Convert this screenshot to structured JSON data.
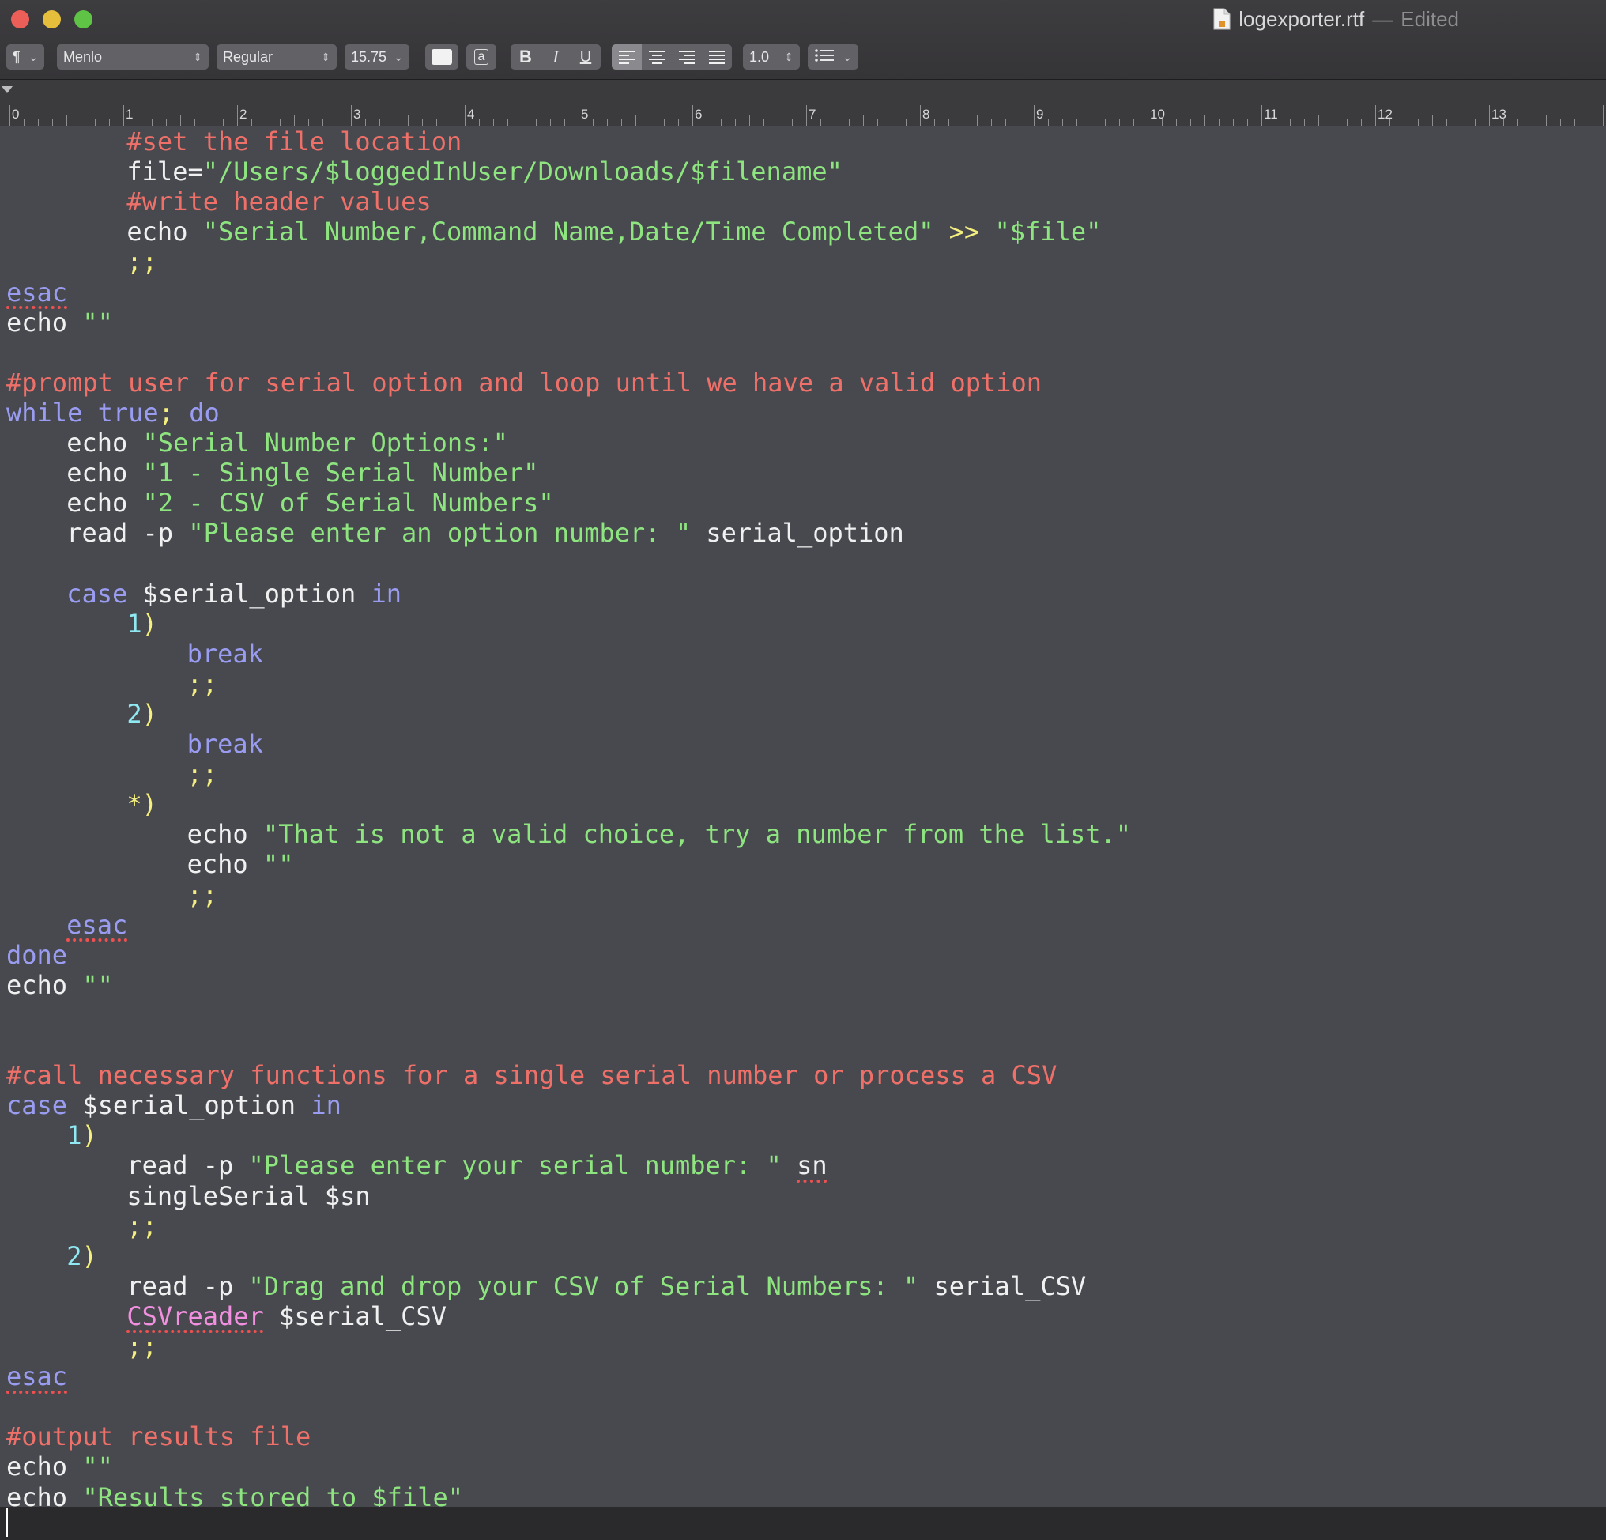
{
  "window": {
    "filename": "logexporter.rtf",
    "separator": "—",
    "status": "Edited",
    "traffic_lights": {
      "close": "#ec5f58",
      "minimize": "#e5bf3c",
      "zoom": "#5fc346"
    }
  },
  "toolbar": {
    "paragraph_style": "¶",
    "font_family": "Menlo",
    "font_style": "Regular",
    "font_size": "15.75",
    "highlight_label": "a",
    "bold": "B",
    "italic": "I",
    "underline": "U",
    "line_spacing": "1.0",
    "list_icon": "list-bullets-icon"
  },
  "ruler": {
    "numbers": [
      "0",
      "1",
      "2",
      "3",
      "4",
      "5",
      "6",
      "7",
      "8",
      "9",
      "10",
      "11",
      "12",
      "13"
    ]
  },
  "editor": {
    "lines": [
      {
        "indent": 8,
        "segs": [
          {
            "t": "#set the file location",
            "c": "cm"
          }
        ]
      },
      {
        "indent": 8,
        "segs": [
          {
            "t": "file=",
            "c": ""
          },
          {
            "t": "\"/Users/$loggedInUser/Downloads/$filename\"",
            "c": "st"
          }
        ]
      },
      {
        "indent": 8,
        "segs": [
          {
            "t": "#write header values",
            "c": "cm"
          }
        ]
      },
      {
        "indent": 8,
        "segs": [
          {
            "t": "echo ",
            "c": ""
          },
          {
            "t": "\"Serial Number,Command Name,Date/Time Completed\"",
            "c": "st"
          },
          {
            "t": " >> ",
            "c": "pu"
          },
          {
            "t": "\"$file\"",
            "c": "st"
          }
        ]
      },
      {
        "indent": 8,
        "segs": [
          {
            "t": ";;",
            "c": "pu"
          }
        ]
      },
      {
        "indent": 0,
        "segs": [
          {
            "t": "esac",
            "c": "kw sp"
          }
        ]
      },
      {
        "indent": 0,
        "segs": [
          {
            "t": "echo ",
            "c": ""
          },
          {
            "t": "\"\"",
            "c": "st"
          }
        ]
      },
      {
        "indent": 0,
        "segs": []
      },
      {
        "indent": 0,
        "segs": [
          {
            "t": "#prompt user for serial option and loop until we have a valid option",
            "c": "cm"
          }
        ]
      },
      {
        "indent": 0,
        "segs": [
          {
            "t": "while true",
            "c": "kw"
          },
          {
            "t": "; ",
            "c": "pu"
          },
          {
            "t": "do",
            "c": "kw"
          }
        ]
      },
      {
        "indent": 4,
        "segs": [
          {
            "t": "echo ",
            "c": ""
          },
          {
            "t": "\"Serial Number Options:\"",
            "c": "st"
          }
        ]
      },
      {
        "indent": 4,
        "segs": [
          {
            "t": "echo ",
            "c": ""
          },
          {
            "t": "\"1 - Single Serial Number\"",
            "c": "st"
          }
        ]
      },
      {
        "indent": 4,
        "segs": [
          {
            "t": "echo ",
            "c": ""
          },
          {
            "t": "\"2 - CSV of Serial Numbers\"",
            "c": "st"
          }
        ]
      },
      {
        "indent": 4,
        "segs": [
          {
            "t": "read -p ",
            "c": ""
          },
          {
            "t": "\"Please enter an option number: \"",
            "c": "st"
          },
          {
            "t": " serial_option",
            "c": ""
          }
        ]
      },
      {
        "indent": 0,
        "segs": []
      },
      {
        "indent": 4,
        "segs": [
          {
            "t": "case ",
            "c": "kw"
          },
          {
            "t": "$serial_option ",
            "c": ""
          },
          {
            "t": "in",
            "c": "kw"
          }
        ]
      },
      {
        "indent": 8,
        "segs": [
          {
            "t": "1",
            "c": "nm"
          },
          {
            "t": ")",
            "c": "pu"
          }
        ]
      },
      {
        "indent": 12,
        "segs": [
          {
            "t": "break",
            "c": "kw"
          }
        ]
      },
      {
        "indent": 12,
        "segs": [
          {
            "t": ";;",
            "c": "pu"
          }
        ]
      },
      {
        "indent": 8,
        "segs": [
          {
            "t": "2",
            "c": "nm"
          },
          {
            "t": ")",
            "c": "pu"
          }
        ]
      },
      {
        "indent": 12,
        "segs": [
          {
            "t": "break",
            "c": "kw"
          }
        ]
      },
      {
        "indent": 12,
        "segs": [
          {
            "t": ";;",
            "c": "pu"
          }
        ]
      },
      {
        "indent": 8,
        "segs": [
          {
            "t": "*)",
            "c": "pu"
          }
        ]
      },
      {
        "indent": 12,
        "segs": [
          {
            "t": "echo ",
            "c": ""
          },
          {
            "t": "\"That is not a valid choice, try a number from the list.\"",
            "c": "st"
          }
        ]
      },
      {
        "indent": 12,
        "segs": [
          {
            "t": "echo ",
            "c": ""
          },
          {
            "t": "\"\"",
            "c": "st"
          }
        ]
      },
      {
        "indent": 12,
        "segs": [
          {
            "t": ";;",
            "c": "pu"
          }
        ]
      },
      {
        "indent": 4,
        "segs": [
          {
            "t": "esac",
            "c": "kw sp"
          }
        ]
      },
      {
        "indent": 0,
        "segs": [
          {
            "t": "done",
            "c": "kw"
          }
        ]
      },
      {
        "indent": 0,
        "segs": [
          {
            "t": "echo ",
            "c": ""
          },
          {
            "t": "\"\"",
            "c": "st"
          }
        ]
      },
      {
        "indent": 0,
        "segs": []
      },
      {
        "indent": 0,
        "segs": []
      },
      {
        "indent": 0,
        "segs": [
          {
            "t": "#call necessary functions for a single serial number or process a CSV",
            "c": "cm"
          }
        ]
      },
      {
        "indent": 0,
        "segs": [
          {
            "t": "case ",
            "c": "kw"
          },
          {
            "t": "$serial_option ",
            "c": ""
          },
          {
            "t": "in",
            "c": "kw"
          }
        ]
      },
      {
        "indent": 4,
        "segs": [
          {
            "t": "1",
            "c": "nm"
          },
          {
            "t": ")",
            "c": "pu"
          }
        ]
      },
      {
        "indent": 8,
        "segs": [
          {
            "t": "read -p ",
            "c": ""
          },
          {
            "t": "\"Please enter your serial number: \"",
            "c": "st"
          },
          {
            "t": " ",
            "c": ""
          },
          {
            "t": "sn",
            "c": "sp"
          }
        ]
      },
      {
        "indent": 8,
        "segs": [
          {
            "t": "singleSerial $sn",
            "c": ""
          }
        ]
      },
      {
        "indent": 8,
        "segs": [
          {
            "t": ";;",
            "c": "pu"
          }
        ]
      },
      {
        "indent": 4,
        "segs": [
          {
            "t": "2",
            "c": "nm"
          },
          {
            "t": ")",
            "c": "pu"
          }
        ]
      },
      {
        "indent": 8,
        "segs": [
          {
            "t": "read -p ",
            "c": ""
          },
          {
            "t": "\"Drag and drop your CSV of Serial Numbers: \"",
            "c": "st"
          },
          {
            "t": " serial_CSV",
            "c": ""
          }
        ]
      },
      {
        "indent": 8,
        "segs": [
          {
            "t": "CSVreader",
            "c": "fn sp"
          },
          {
            "t": " $serial_CSV",
            "c": ""
          }
        ]
      },
      {
        "indent": 8,
        "segs": [
          {
            "t": ";;",
            "c": "pu"
          }
        ]
      },
      {
        "indent": 0,
        "segs": [
          {
            "t": "esac",
            "c": "kw sp"
          }
        ]
      },
      {
        "indent": 0,
        "segs": []
      },
      {
        "indent": 0,
        "segs": [
          {
            "t": "#output results file",
            "c": "cm"
          }
        ]
      },
      {
        "indent": 0,
        "segs": [
          {
            "t": "echo ",
            "c": ""
          },
          {
            "t": "\"\"",
            "c": "st"
          }
        ]
      },
      {
        "indent": 0,
        "segs": [
          {
            "t": "echo ",
            "c": ""
          },
          {
            "t": "\"Results stored to $file\"",
            "c": "st"
          }
        ]
      }
    ]
  }
}
